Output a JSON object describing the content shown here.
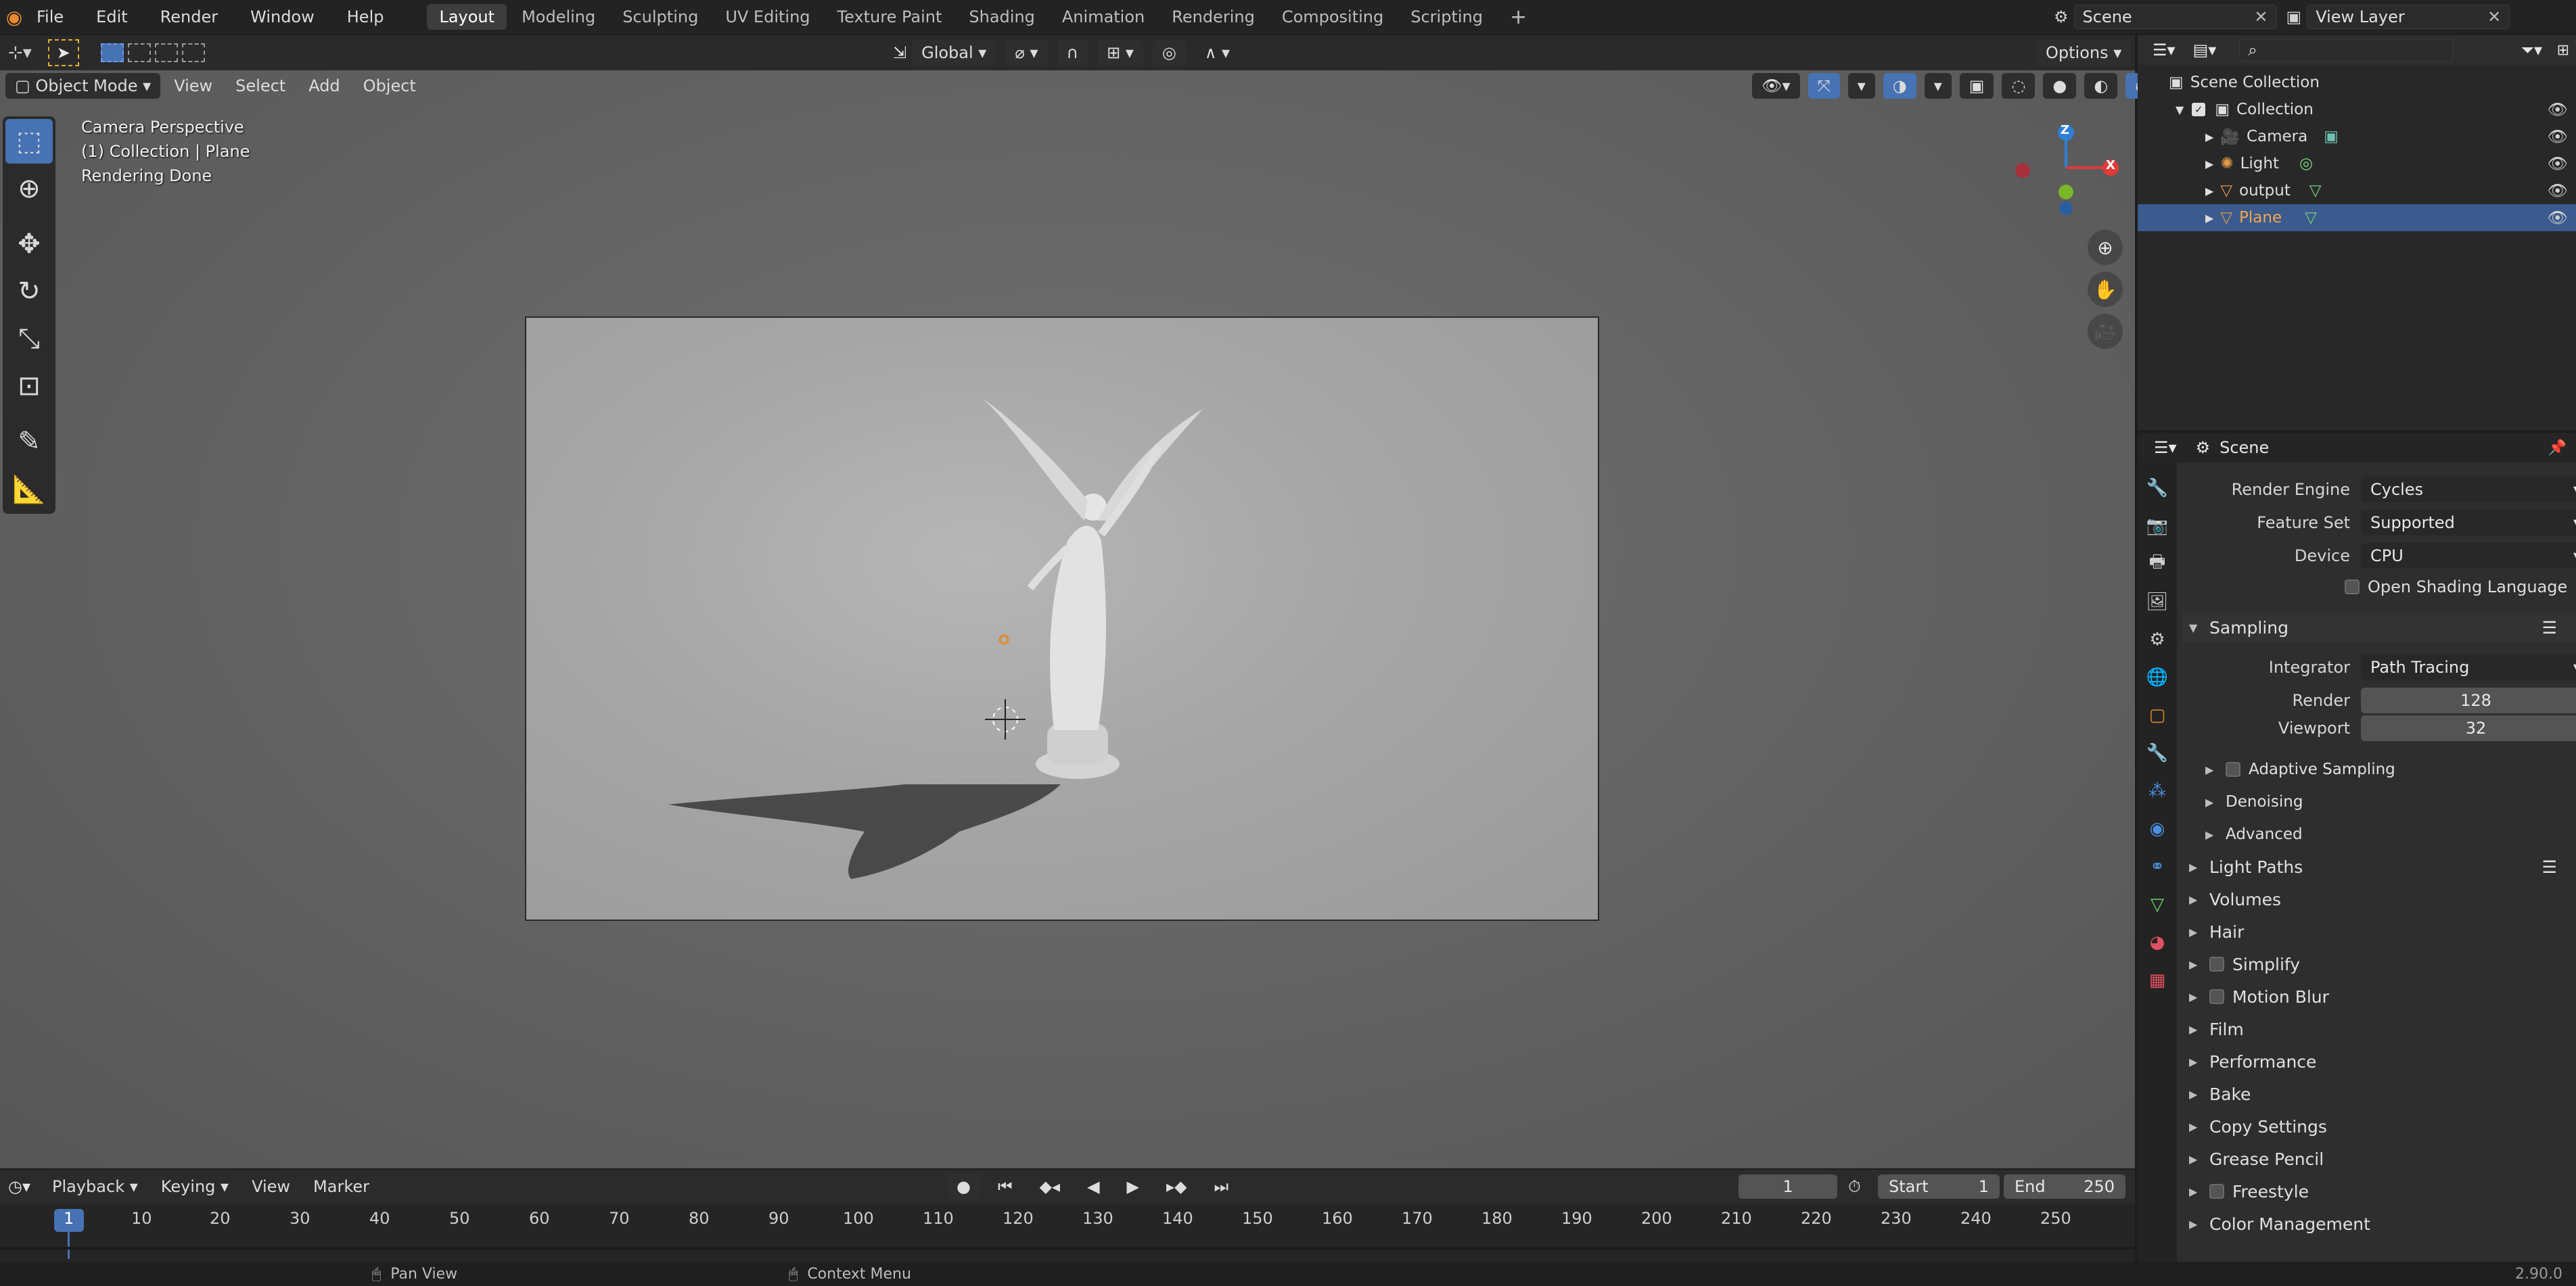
{
  "topbar": {
    "menu": [
      "File",
      "Edit",
      "Render",
      "Window",
      "Help"
    ],
    "workspaces": [
      "Layout",
      "Modeling",
      "Sculpting",
      "UV Editing",
      "Texture Paint",
      "Shading",
      "Animation",
      "Rendering",
      "Compositing",
      "Scripting"
    ],
    "active_workspace": "Layout",
    "add_tab": "+",
    "scene": "Scene",
    "view_layer": "View Layer"
  },
  "viewport_header": {
    "mode": "Object Mode",
    "menus": [
      "View",
      "Select",
      "Add",
      "Object"
    ],
    "orientation": "Global",
    "options": "Options"
  },
  "overlay": {
    "line1": "Camera Perspective",
    "line2": "(1) Collection | Plane",
    "line3": "Rendering Done"
  },
  "gizmo": {
    "z": "Z",
    "x": "X"
  },
  "outliner": {
    "root": "Scene Collection",
    "collection": "Collection",
    "items": [
      "Camera",
      "Light",
      "output",
      "Plane"
    ],
    "selected": "Plane",
    "search_placeholder": ""
  },
  "properties": {
    "header": "Scene",
    "render_engine_label": "Render Engine",
    "render_engine": "Cycles",
    "feature_set_label": "Feature Set",
    "feature_set": "Supported",
    "device_label": "Device",
    "device": "CPU",
    "osl": "Open Shading Language",
    "sampling": "Sampling",
    "integrator_label": "Integrator",
    "integrator": "Path Tracing",
    "render_label": "Render",
    "render_samples": "128",
    "viewport_label": "Viewport",
    "viewport_samples": "32",
    "sub_panels": [
      "Adaptive Sampling",
      "Denoising",
      "Advanced"
    ],
    "panels": [
      "Light Paths",
      "Volumes",
      "Hair",
      "Simplify",
      "Motion Blur",
      "Film",
      "Performance",
      "Bake",
      "Copy Settings",
      "Grease Pencil",
      "Freestyle",
      "Color Management"
    ]
  },
  "timeline": {
    "menus": [
      "Playback",
      "Keying",
      "View",
      "Marker"
    ],
    "current_frame": "1",
    "start_label": "Start",
    "start": "1",
    "end_label": "End",
    "end": "250",
    "ticks": [
      "1",
      "10",
      "20",
      "30",
      "40",
      "50",
      "60",
      "70",
      "80",
      "90",
      "100",
      "110",
      "120",
      "130",
      "140",
      "150",
      "160",
      "170",
      "180",
      "190",
      "200",
      "210",
      "220",
      "230",
      "240",
      "250"
    ]
  },
  "status": {
    "pan": "Pan View",
    "context": "Context Menu",
    "version": "2.90.0"
  },
  "colors": {
    "accent": "#4772b3",
    "selected_row": "#3b5a8e",
    "axis_x": "#e03a3a",
    "axis_y": "#7ab52a",
    "axis_z": "#2f7fd6"
  }
}
